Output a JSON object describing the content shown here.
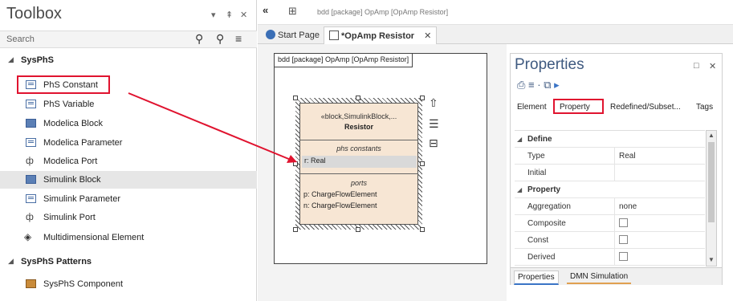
{
  "toolbox": {
    "title": "Toolbox",
    "controls": [
      "▾",
      "⇞",
      "✕"
    ],
    "search_placeholder": "Search",
    "sections": [
      {
        "label": "SysPhS",
        "items": [
          "PhS Constant",
          "PhS Variable",
          "Modelica Block",
          "Modelica Parameter",
          "Modelica Port",
          "Simulink Block",
          "Simulink Parameter",
          "Simulink Port",
          "Multidimensional Element"
        ]
      },
      {
        "label": "SysPhS Patterns",
        "items": [
          "SysPhS Component"
        ]
      }
    ],
    "selected_item": "Simulink Block"
  },
  "diagram": {
    "nav": "«",
    "path": "bdd [package] OpAmp [OpAmp Resistor]",
    "tabs": [
      {
        "label": "Start Page"
      },
      {
        "label": "*OpAmp Resistor",
        "close": "✕"
      }
    ],
    "frame_label": "bdd [package] OpAmp [OpAmp Resistor]",
    "block": {
      "stereotype": "«block,SimulinkBlock,...",
      "name": "Resistor",
      "constants_header": "phs constants",
      "constant": "r: Real",
      "ports_header": "ports",
      "ports": [
        "p: ChargeFlowElement",
        "n: ChargeFlowElement"
      ]
    }
  },
  "properties": {
    "title": "Properties",
    "controls": [
      "□",
      "✕"
    ],
    "tabs": [
      "Element",
      "Property",
      "Redefined/Subset...",
      "Tags"
    ],
    "groups": [
      {
        "label": "Define",
        "rows": [
          {
            "name": "Type",
            "value": "Real"
          },
          {
            "name": "Initial",
            "value": ""
          }
        ]
      },
      {
        "label": "Property",
        "rows": [
          {
            "name": "Aggregation",
            "value": "none"
          },
          {
            "name": "Composite",
            "checkbox": false
          },
          {
            "name": "Const",
            "checkbox": false
          },
          {
            "name": "Derived",
            "checkbox": false
          }
        ]
      }
    ],
    "bottom_tabs": [
      "Properties",
      "DMN Simulation"
    ]
  },
  "colors": {
    "highlight": "#e0132f",
    "accent": "#3a74c6"
  }
}
